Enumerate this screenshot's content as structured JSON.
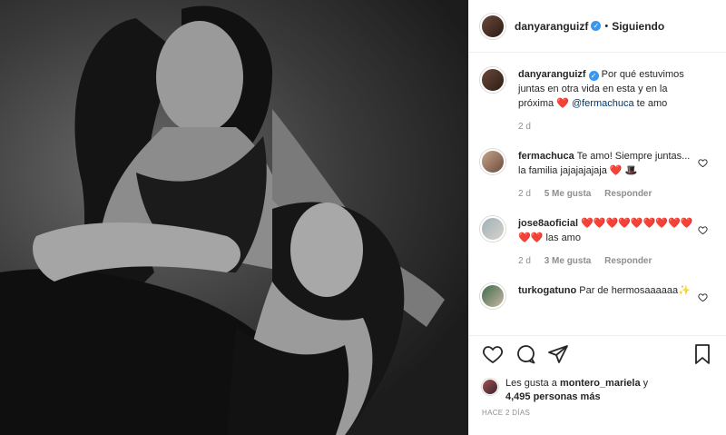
{
  "header": {
    "username": "danyaranguizf",
    "verified_mark": "✓",
    "separator": "•",
    "follow_label": "Siguiendo"
  },
  "caption": {
    "username": "danyaranguizf",
    "text": "Por qué estuvimos juntas en otra vida en esta y en la próxima",
    "emoji": "❤️",
    "mention": "@fermachuca",
    "tail": "te amo",
    "time": "2 d"
  },
  "comments": [
    {
      "username": "fermachuca",
      "text": "Te amo! Siempre juntas... la familia jajajajajaja ❤️ 🎩",
      "time": "2 d",
      "likes": "5 Me gusta",
      "reply": "Responder"
    },
    {
      "username": "jose8aoficial",
      "text": "❤️❤️❤️❤️❤️❤️❤️❤️❤️❤️❤️ las amo",
      "time": "2 d",
      "likes": "3 Me gusta",
      "reply": "Responder"
    },
    {
      "username": "turkogatuno",
      "text": "Par de hermosaaaaaa✨"
    }
  ],
  "actions": {
    "like_icon": "heart-outline-icon",
    "comment_icon": "comment-icon",
    "share_icon": "share-icon",
    "save_icon": "bookmark-icon"
  },
  "likes": {
    "prefix": "Les gusta a",
    "user": "montero_mariela",
    "joiner": "y",
    "count": "4,495 personas más"
  },
  "timestamp": "HACE 2 DÍAS",
  "colors": {
    "verified": "#3897f0",
    "mention": "#00376b",
    "muted": "#8e8e8e",
    "heart": "#ed4956"
  }
}
